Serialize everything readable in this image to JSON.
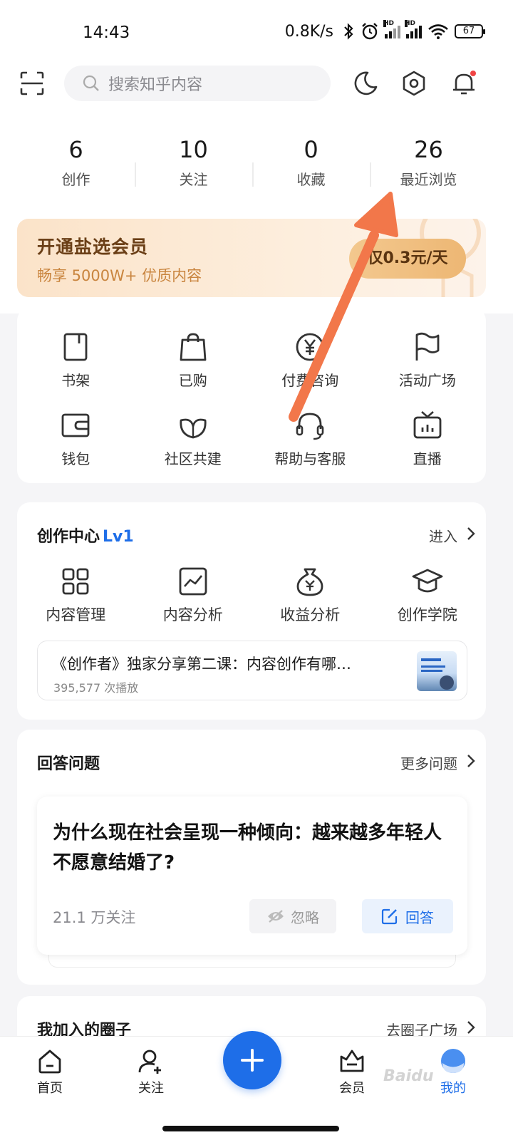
{
  "status_bar": {
    "time": "14:43",
    "network_speed": "0.8K/s",
    "hd_badge": "HD",
    "battery": "67",
    "icons": [
      "bluetooth-icon",
      "alarm-icon",
      "signal-icon",
      "wifi-icon",
      "battery-icon"
    ]
  },
  "header": {
    "search_placeholder": "搜索知乎内容",
    "icons": [
      "scan-icon",
      "search-icon",
      "night-mode-icon",
      "settings-icon",
      "notification-bell-icon"
    ]
  },
  "stats": [
    {
      "value": "6",
      "label": "创作"
    },
    {
      "value": "10",
      "label": "关注"
    },
    {
      "value": "0",
      "label": "收藏"
    },
    {
      "value": "26",
      "label": "最近浏览"
    }
  ],
  "vip_banner": {
    "title": "开通盐选会员",
    "subtitle": "畅享 5000W+ 优质内容",
    "button": "仅0.3元/天"
  },
  "tools": [
    {
      "label": "书架",
      "icon": "bookshelf-icon"
    },
    {
      "label": "已购",
      "icon": "shopping-bag-icon"
    },
    {
      "label": "付费咨询",
      "icon": "yuan-coin-icon"
    },
    {
      "label": "活动广场",
      "icon": "flag-icon"
    },
    {
      "label": "钱包",
      "icon": "wallet-icon"
    },
    {
      "label": "社区共建",
      "icon": "leaf-icon"
    },
    {
      "label": "帮助与客服",
      "icon": "headset-icon"
    },
    {
      "label": "直播",
      "icon": "tv-icon"
    }
  ],
  "creation_center": {
    "title": "创作中心",
    "level": "Lv1",
    "enter": "进入",
    "items": [
      {
        "label": "内容管理",
        "icon": "grid-icon"
      },
      {
        "label": "内容分析",
        "icon": "chart-icon"
      },
      {
        "label": "收益分析",
        "icon": "money-bag-icon"
      },
      {
        "label": "创作学院",
        "icon": "graduation-cap-icon"
      }
    ],
    "video": {
      "title": "《创作者》独家分享第二课：内容创作有哪…",
      "plays": "395,577 次播放"
    }
  },
  "answer_questions": {
    "title": "回答问题",
    "more": "更多问题",
    "question": "为什么现在社会呈现一种倾向：越来越多年轻人不愿意结婚了?",
    "followers": "21.1 万关注",
    "ignore": "忽略",
    "answer": "回答"
  },
  "circles": {
    "title": "我加入的圈子",
    "link": "去圈子广场"
  },
  "bottom_nav": {
    "items": [
      {
        "label": "首页",
        "icon": "home-icon"
      },
      {
        "label": "关注",
        "icon": "follow-icon"
      },
      {
        "label": "会员",
        "icon": "vip-icon"
      },
      {
        "label": "我的",
        "icon": "profile-icon"
      }
    ],
    "fab_icon": "plus-icon"
  },
  "watermark": "Baidu"
}
